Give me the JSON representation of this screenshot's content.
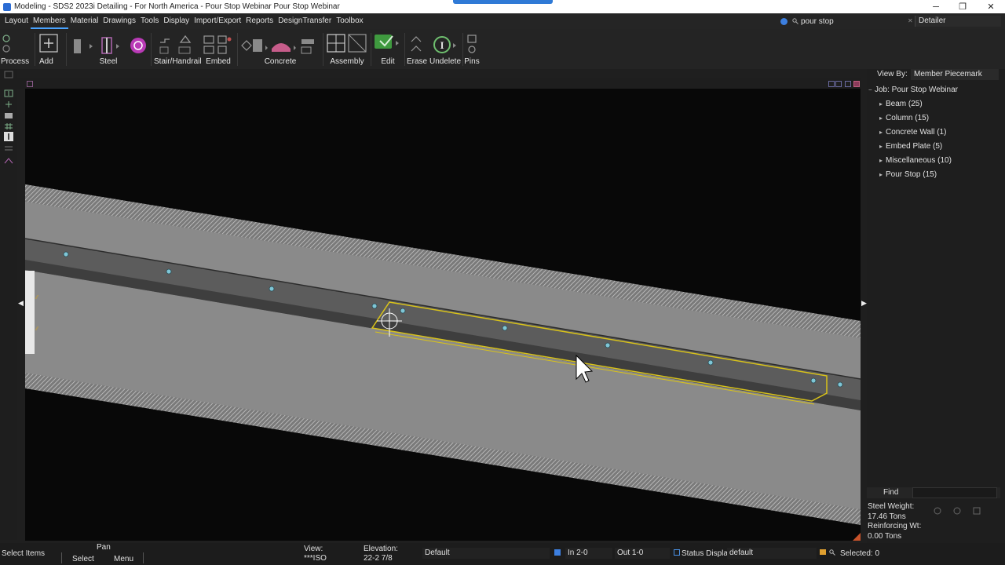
{
  "window": {
    "title": "Modeling - SDS2 2023i Detailing - For North America - Pour Stop Webinar Pour Stop Webinar",
    "minimize": "─",
    "maximize": "❐",
    "close": "✕"
  },
  "menu": {
    "items": [
      "Layout",
      "Members",
      "Material",
      "Drawings",
      "Tools",
      "Display",
      "Import/Export",
      "Reports",
      "DesignTransfer",
      "Toolbox"
    ],
    "active": "Members",
    "search_value": "pour stop",
    "role": "Detailer"
  },
  "ribbon": {
    "process": "Process",
    "add": "Add",
    "steel": "Steel",
    "stair": "Stair/Handrail",
    "embed": "Embed",
    "concrete": "Concrete",
    "assembly": "Assembly",
    "edit": "Edit",
    "erase": "Erase",
    "undelete": "Undelete",
    "pins": "Pins"
  },
  "panel": {
    "view_by_label": "View By:",
    "view_by_value": "Member Piecemark",
    "job": "Job: Pour Stop Webinar",
    "items": [
      "Beam (25)",
      "Column (15)",
      "Concrete Wall (1)",
      "Embed Plate (5)",
      "Miscellaneous (10)",
      "Pour Stop (15)"
    ],
    "find_label": "Find",
    "steel_weight_label": "Steel Weight:",
    "steel_weight_value": "17.46 Tons",
    "reinforcing_label": "Reinforcing Wt:",
    "reinforcing_value": "0.00 Tons"
  },
  "status": {
    "mode": "Select Items",
    "pan": "Pan",
    "select": "Select",
    "menu": "Menu",
    "view_label": "View:",
    "view_value": "***ISO",
    "elevation_label": "Elevation:",
    "elevation_value": "22-2 7/8",
    "layer": "Default",
    "in_value": "In 2-0",
    "out_value": "Out 1-0",
    "status_display_label": "Status Display",
    "status_display_value": "default",
    "selected": "Selected: 0"
  },
  "colors": {
    "accent": "#2f7ad6",
    "selection": "#d8c21a",
    "bolt": "#7fc6d6",
    "concrete": "#8a8a8a",
    "beam_dark": "#4a4a4a"
  }
}
